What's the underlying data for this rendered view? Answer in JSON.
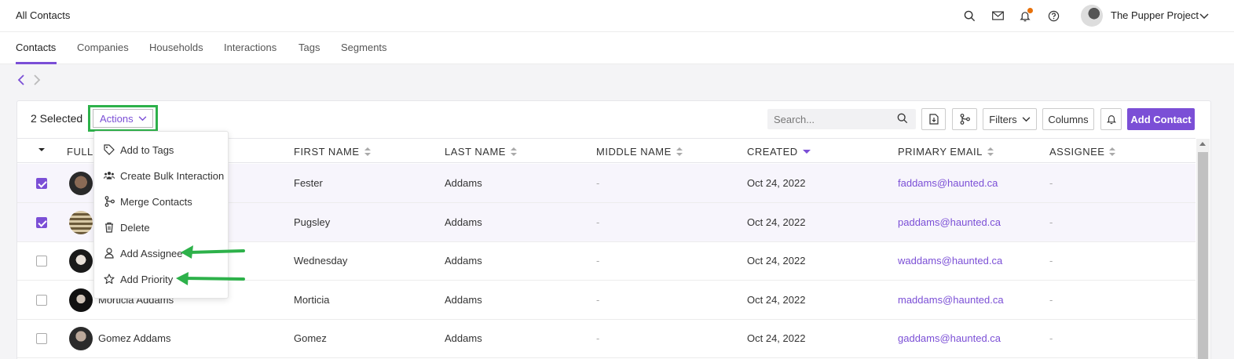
{
  "header": {
    "title": "All Contacts",
    "org_name": "The Pupper Project",
    "icons": [
      "search-icon",
      "mail-icon",
      "bell-icon",
      "help-icon"
    ]
  },
  "tabs": [
    {
      "label": "Contacts",
      "active": true
    },
    {
      "label": "Companies"
    },
    {
      "label": "Households"
    },
    {
      "label": "Interactions"
    },
    {
      "label": "Tags"
    },
    {
      "label": "Segments"
    }
  ],
  "toolbar": {
    "selected_label": "2 Selected",
    "actions_label": "Actions",
    "search_placeholder": "Search...",
    "filters_label": "Filters",
    "columns_label": "Columns",
    "add_contact_label": "Add Contact"
  },
  "columns": {
    "full": "FULL",
    "first": "FIRST NAME",
    "last": "LAST NAME",
    "middle": "MIDDLE NAME",
    "created": "CREATED",
    "email": "PRIMARY EMAIL",
    "assignee": "ASSIGNEE"
  },
  "rows": [
    {
      "full": "",
      "first": "Fester",
      "last": "Addams",
      "middle": "-",
      "created": "Oct 24, 2022",
      "email": "faddams@haunted.ca",
      "assignee": "-",
      "checked": true
    },
    {
      "full": "",
      "first": "Pugsley",
      "last": "Addams",
      "middle": "-",
      "created": "Oct 24, 2022",
      "email": "paddams@haunted.ca",
      "assignee": "-",
      "checked": true
    },
    {
      "full": "",
      "first": "Wednesday",
      "last": "Addams",
      "middle": "-",
      "created": "Oct 24, 2022",
      "email": "waddams@haunted.ca",
      "assignee": "-",
      "checked": false
    },
    {
      "full": "Morticia Addams",
      "first": "Morticia",
      "last": "Addams",
      "middle": "-",
      "created": "Oct 24, 2022",
      "email": "maddams@haunted.ca",
      "assignee": "-",
      "checked": false
    },
    {
      "full": "Gomez Addams",
      "first": "Gomez",
      "last": "Addams",
      "middle": "-",
      "created": "Oct 24, 2022",
      "email": "gaddams@haunted.ca",
      "assignee": "-",
      "checked": false
    }
  ],
  "actions_menu": [
    {
      "label": "Add to Tags",
      "icon": "tag-icon"
    },
    {
      "label": "Create Bulk Interaction",
      "icon": "people-icon"
    },
    {
      "label": "Merge Contacts",
      "icon": "merge-icon"
    },
    {
      "label": "Delete",
      "icon": "trash-icon"
    },
    {
      "label": "Add Assignee",
      "icon": "user-icon"
    },
    {
      "label": "Add Priority",
      "icon": "star-icon"
    }
  ],
  "colors": {
    "accent": "#7b4fd6",
    "highlight": "#2db14a",
    "notification": "#e8710a"
  }
}
